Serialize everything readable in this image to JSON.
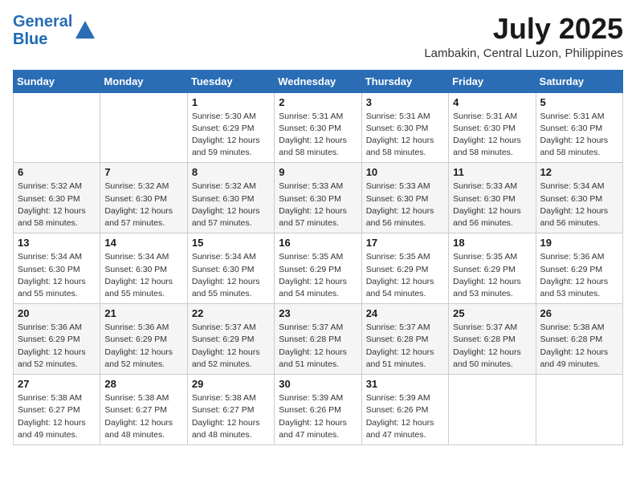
{
  "header": {
    "logo_line1": "General",
    "logo_line2": "Blue",
    "month": "July 2025",
    "location": "Lambakin, Central Luzon, Philippines"
  },
  "weekdays": [
    "Sunday",
    "Monday",
    "Tuesday",
    "Wednesday",
    "Thursday",
    "Friday",
    "Saturday"
  ],
  "weeks": [
    [
      {
        "day": "",
        "info": ""
      },
      {
        "day": "",
        "info": ""
      },
      {
        "day": "1",
        "info": "Sunrise: 5:30 AM\nSunset: 6:29 PM\nDaylight: 12 hours and 59 minutes."
      },
      {
        "day": "2",
        "info": "Sunrise: 5:31 AM\nSunset: 6:30 PM\nDaylight: 12 hours and 58 minutes."
      },
      {
        "day": "3",
        "info": "Sunrise: 5:31 AM\nSunset: 6:30 PM\nDaylight: 12 hours and 58 minutes."
      },
      {
        "day": "4",
        "info": "Sunrise: 5:31 AM\nSunset: 6:30 PM\nDaylight: 12 hours and 58 minutes."
      },
      {
        "day": "5",
        "info": "Sunrise: 5:31 AM\nSunset: 6:30 PM\nDaylight: 12 hours and 58 minutes."
      }
    ],
    [
      {
        "day": "6",
        "info": "Sunrise: 5:32 AM\nSunset: 6:30 PM\nDaylight: 12 hours and 58 minutes."
      },
      {
        "day": "7",
        "info": "Sunrise: 5:32 AM\nSunset: 6:30 PM\nDaylight: 12 hours and 57 minutes."
      },
      {
        "day": "8",
        "info": "Sunrise: 5:32 AM\nSunset: 6:30 PM\nDaylight: 12 hours and 57 minutes."
      },
      {
        "day": "9",
        "info": "Sunrise: 5:33 AM\nSunset: 6:30 PM\nDaylight: 12 hours and 57 minutes."
      },
      {
        "day": "10",
        "info": "Sunrise: 5:33 AM\nSunset: 6:30 PM\nDaylight: 12 hours and 56 minutes."
      },
      {
        "day": "11",
        "info": "Sunrise: 5:33 AM\nSunset: 6:30 PM\nDaylight: 12 hours and 56 minutes."
      },
      {
        "day": "12",
        "info": "Sunrise: 5:34 AM\nSunset: 6:30 PM\nDaylight: 12 hours and 56 minutes."
      }
    ],
    [
      {
        "day": "13",
        "info": "Sunrise: 5:34 AM\nSunset: 6:30 PM\nDaylight: 12 hours and 55 minutes."
      },
      {
        "day": "14",
        "info": "Sunrise: 5:34 AM\nSunset: 6:30 PM\nDaylight: 12 hours and 55 minutes."
      },
      {
        "day": "15",
        "info": "Sunrise: 5:34 AM\nSunset: 6:30 PM\nDaylight: 12 hours and 55 minutes."
      },
      {
        "day": "16",
        "info": "Sunrise: 5:35 AM\nSunset: 6:29 PM\nDaylight: 12 hours and 54 minutes."
      },
      {
        "day": "17",
        "info": "Sunrise: 5:35 AM\nSunset: 6:29 PM\nDaylight: 12 hours and 54 minutes."
      },
      {
        "day": "18",
        "info": "Sunrise: 5:35 AM\nSunset: 6:29 PM\nDaylight: 12 hours and 53 minutes."
      },
      {
        "day": "19",
        "info": "Sunrise: 5:36 AM\nSunset: 6:29 PM\nDaylight: 12 hours and 53 minutes."
      }
    ],
    [
      {
        "day": "20",
        "info": "Sunrise: 5:36 AM\nSunset: 6:29 PM\nDaylight: 12 hours and 52 minutes."
      },
      {
        "day": "21",
        "info": "Sunrise: 5:36 AM\nSunset: 6:29 PM\nDaylight: 12 hours and 52 minutes."
      },
      {
        "day": "22",
        "info": "Sunrise: 5:37 AM\nSunset: 6:29 PM\nDaylight: 12 hours and 52 minutes."
      },
      {
        "day": "23",
        "info": "Sunrise: 5:37 AM\nSunset: 6:28 PM\nDaylight: 12 hours and 51 minutes."
      },
      {
        "day": "24",
        "info": "Sunrise: 5:37 AM\nSunset: 6:28 PM\nDaylight: 12 hours and 51 minutes."
      },
      {
        "day": "25",
        "info": "Sunrise: 5:37 AM\nSunset: 6:28 PM\nDaylight: 12 hours and 50 minutes."
      },
      {
        "day": "26",
        "info": "Sunrise: 5:38 AM\nSunset: 6:28 PM\nDaylight: 12 hours and 49 minutes."
      }
    ],
    [
      {
        "day": "27",
        "info": "Sunrise: 5:38 AM\nSunset: 6:27 PM\nDaylight: 12 hours and 49 minutes."
      },
      {
        "day": "28",
        "info": "Sunrise: 5:38 AM\nSunset: 6:27 PM\nDaylight: 12 hours and 48 minutes."
      },
      {
        "day": "29",
        "info": "Sunrise: 5:38 AM\nSunset: 6:27 PM\nDaylight: 12 hours and 48 minutes."
      },
      {
        "day": "30",
        "info": "Sunrise: 5:39 AM\nSunset: 6:26 PM\nDaylight: 12 hours and 47 minutes."
      },
      {
        "day": "31",
        "info": "Sunrise: 5:39 AM\nSunset: 6:26 PM\nDaylight: 12 hours and 47 minutes."
      },
      {
        "day": "",
        "info": ""
      },
      {
        "day": "",
        "info": ""
      }
    ]
  ]
}
